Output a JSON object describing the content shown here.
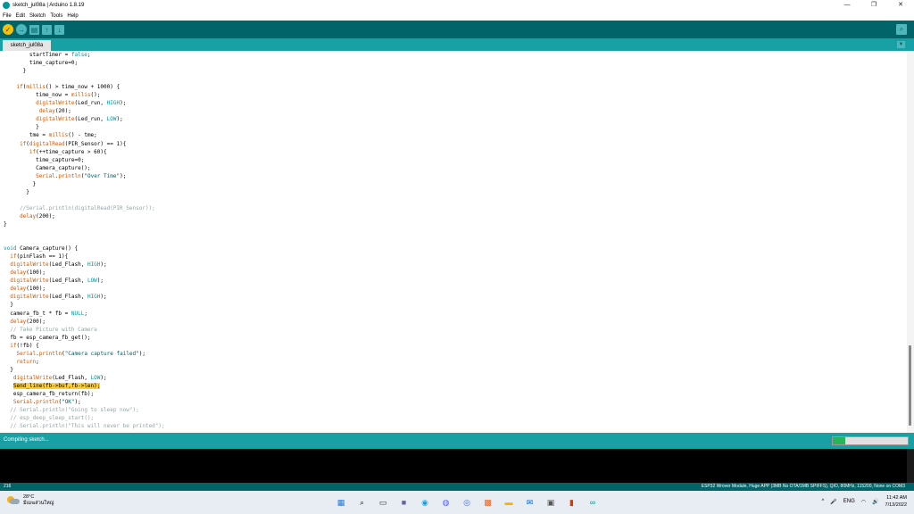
{
  "window": {
    "title": "sketch_jul08a | Arduino 1.8.19",
    "minimize_glyph": "—",
    "maximize_glyph": "❐",
    "close_glyph": "✕"
  },
  "menu": [
    "File",
    "Edit",
    "Sketch",
    "Tools",
    "Help"
  ],
  "toolbar": {
    "verify_glyph": "✓",
    "upload_glyph": "→",
    "new_glyph": "▤",
    "open_glyph": "↑",
    "save_glyph": "↓",
    "serial_monitor_glyph": "⌕"
  },
  "tabs": [
    {
      "label": "sketch_jul08a"
    }
  ],
  "tab_menu_glyph": "▼",
  "status": {
    "message": "Compiling sketch...",
    "progress": 0.17
  },
  "footer": {
    "line_number": "216",
    "board": "ESP32 Wrover Module, Huge APP (3MB No OTA/1MB SPIFFS), QIO, 80MHz, 115200, None on COM3"
  },
  "taskbar": {
    "weather_temp": "28°C",
    "weather_desc": "มีเมฆส่วนใหญ่",
    "lang": "ENG",
    "time": "11:42 AM",
    "date": "7/13/2022",
    "tray_up_glyph": "^",
    "mic_glyph": "🎤",
    "wifi_glyph": "◠",
    "volume_glyph": "🔊",
    "icons": [
      {
        "name": "windows-start-icon",
        "glyph": "▦",
        "color": "#1f7ae0"
      },
      {
        "name": "search-icon",
        "glyph": "⌕",
        "color": "#222222"
      },
      {
        "name": "task-view-icon",
        "glyph": "▭",
        "color": "#333333"
      },
      {
        "name": "chat-icon",
        "glyph": "■",
        "color": "#6264a7"
      },
      {
        "name": "edge-icon",
        "glyph": "◉",
        "color": "#1aa0d8"
      },
      {
        "name": "discord-icon",
        "glyph": "◍",
        "color": "#5865f2"
      },
      {
        "name": "app-icon",
        "glyph": "◎",
        "color": "#4a6cd4"
      },
      {
        "name": "paint-icon",
        "glyph": "▩",
        "color": "#e06a2c"
      },
      {
        "name": "file-explorer-icon",
        "glyph": "▬",
        "color": "#f4b400"
      },
      {
        "name": "mail-icon",
        "glyph": "✉",
        "color": "#0a64c8"
      },
      {
        "name": "store-icon",
        "glyph": "▣",
        "color": "#555555"
      },
      {
        "name": "office-icon",
        "glyph": "▮",
        "color": "#d83b01"
      },
      {
        "name": "arduino-icon",
        "glyph": "∞",
        "color": "#00979c"
      }
    ]
  },
  "code_lines": [
    [
      {
        "t": "        startTimer = "
      },
      {
        "t": "false",
        "c": "lit"
      },
      {
        "t": ";"
      }
    ],
    [
      {
        "t": "        time_capture=0;"
      }
    ],
    [
      {
        "t": "      }"
      }
    ],
    [
      {
        "t": ""
      }
    ],
    [
      {
        "t": "    "
      },
      {
        "t": "if",
        "c": "kw"
      },
      {
        "t": "("
      },
      {
        "t": "millis",
        "c": "fn"
      },
      {
        "t": "() > time_now + 1000) {"
      }
    ],
    [
      {
        "t": "          time_now = "
      },
      {
        "t": "millis",
        "c": "fn"
      },
      {
        "t": "();"
      }
    ],
    [
      {
        "t": "          "
      },
      {
        "t": "digitalWrite",
        "c": "fn"
      },
      {
        "t": "(Led_run, "
      },
      {
        "t": "HIGH",
        "c": "lit"
      },
      {
        "t": ");"
      }
    ],
    [
      {
        "t": "           "
      },
      {
        "t": "delay",
        "c": "fn"
      },
      {
        "t": "(20);"
      }
    ],
    [
      {
        "t": "          "
      },
      {
        "t": "digitalWrite",
        "c": "fn"
      },
      {
        "t": "(Led_run, "
      },
      {
        "t": "LOW",
        "c": "lit"
      },
      {
        "t": ");"
      }
    ],
    [
      {
        "t": "          }"
      }
    ],
    [
      {
        "t": "        tme = "
      },
      {
        "t": "millis",
        "c": "fn"
      },
      {
        "t": "() - tme;"
      }
    ],
    [
      {
        "t": "     "
      },
      {
        "t": "if",
        "c": "kw"
      },
      {
        "t": "("
      },
      {
        "t": "digitalRead",
        "c": "fn"
      },
      {
        "t": "(PIR_Sensor) == 1){"
      }
    ],
    [
      {
        "t": "        "
      },
      {
        "t": "if",
        "c": "kw"
      },
      {
        "t": "(++time_capture > 60){"
      }
    ],
    [
      {
        "t": "          time_capture=0;"
      }
    ],
    [
      {
        "t": "          Camera_capture();"
      }
    ],
    [
      {
        "t": "          "
      },
      {
        "t": "Serial",
        "c": "fn"
      },
      {
        "t": "."
      },
      {
        "t": "println",
        "c": "fn"
      },
      {
        "t": "("
      },
      {
        "t": "\"Over Time\"",
        "c": "str"
      },
      {
        "t": ");"
      }
    ],
    [
      {
        "t": "         }"
      }
    ],
    [
      {
        "t": "       }"
      }
    ],
    [
      {
        "t": ""
      }
    ],
    [
      {
        "t": "     "
      },
      {
        "t": "//Serial.println(digitalRead(PIR_Sensor));",
        "c": "cm"
      }
    ],
    [
      {
        "t": "     "
      },
      {
        "t": "delay",
        "c": "fn"
      },
      {
        "t": "(200);"
      }
    ],
    [
      {
        "t": "}"
      }
    ],
    [
      {
        "t": ""
      }
    ],
    [
      {
        "t": ""
      }
    ],
    [
      {
        "t": "void",
        "c": "lit"
      },
      {
        "t": " Camera_capture() {"
      }
    ],
    [
      {
        "t": "  "
      },
      {
        "t": "if",
        "c": "kw"
      },
      {
        "t": "(pinFlash == 1){"
      }
    ],
    [
      {
        "t": "  "
      },
      {
        "t": "digitalWrite",
        "c": "fn"
      },
      {
        "t": "(Led_Flash, "
      },
      {
        "t": "HIGH",
        "c": "lit"
      },
      {
        "t": ");"
      }
    ],
    [
      {
        "t": "  "
      },
      {
        "t": "delay",
        "c": "fn"
      },
      {
        "t": "(100);"
      }
    ],
    [
      {
        "t": "  "
      },
      {
        "t": "digitalWrite",
        "c": "fn"
      },
      {
        "t": "(Led_Flash, "
      },
      {
        "t": "LOW",
        "c": "lit"
      },
      {
        "t": ");"
      }
    ],
    [
      {
        "t": "  "
      },
      {
        "t": "delay",
        "c": "fn"
      },
      {
        "t": "(100);"
      }
    ],
    [
      {
        "t": "  "
      },
      {
        "t": "digitalWrite",
        "c": "fn"
      },
      {
        "t": "(Led_Flash, "
      },
      {
        "t": "HIGH",
        "c": "lit"
      },
      {
        "t": ");"
      }
    ],
    [
      {
        "t": "  }"
      }
    ],
    [
      {
        "t": "  camera_fb_t * fb = "
      },
      {
        "t": "NULL",
        "c": "lit"
      },
      {
        "t": ";"
      }
    ],
    [
      {
        "t": "  "
      },
      {
        "t": "delay",
        "c": "fn"
      },
      {
        "t": "(200);"
      }
    ],
    [
      {
        "t": "  "
      },
      {
        "t": "// Take Picture with Camera",
        "c": "cm"
      }
    ],
    [
      {
        "t": "  fb = esp_camera_fb_get();"
      }
    ],
    [
      {
        "t": "  "
      },
      {
        "t": "if",
        "c": "kw"
      },
      {
        "t": "(!fb) {"
      }
    ],
    [
      {
        "t": "    "
      },
      {
        "t": "Serial",
        "c": "fn"
      },
      {
        "t": "."
      },
      {
        "t": "println",
        "c": "fn"
      },
      {
        "t": "("
      },
      {
        "t": "\"Camera capture failed\"",
        "c": "str"
      },
      {
        "t": ");"
      }
    ],
    [
      {
        "t": "    "
      },
      {
        "t": "return",
        "c": "kw"
      },
      {
        "t": ";"
      }
    ],
    [
      {
        "t": "  }"
      }
    ],
    [
      {
        "t": "   "
      },
      {
        "t": "digitalWrite",
        "c": "fn"
      },
      {
        "t": "(Led_Flash, "
      },
      {
        "t": "LOW",
        "c": "lit"
      },
      {
        "t": ");"
      }
    ],
    [
      {
        "t": "   "
      },
      {
        "t": "Send_line(fb->buf,fb->len);",
        "c": "hl"
      }
    ],
    [
      {
        "t": "   esp_camera_fb_return(fb);"
      }
    ],
    [
      {
        "t": "   "
      },
      {
        "t": "Serial",
        "c": "fn"
      },
      {
        "t": "."
      },
      {
        "t": "println",
        "c": "fn"
      },
      {
        "t": "("
      },
      {
        "t": "\"OK\"",
        "c": "str"
      },
      {
        "t": ");"
      }
    ],
    [
      {
        "t": "  "
      },
      {
        "t": "// Serial.println(\"Going to sleep now\");",
        "c": "cm"
      }
    ],
    [
      {
        "t": "  "
      },
      {
        "t": "// esp_deep_sleep_start();",
        "c": "cm"
      }
    ],
    [
      {
        "t": "  "
      },
      {
        "t": "// Serial.println(\"This will never be printed\");",
        "c": "cm"
      }
    ]
  ]
}
